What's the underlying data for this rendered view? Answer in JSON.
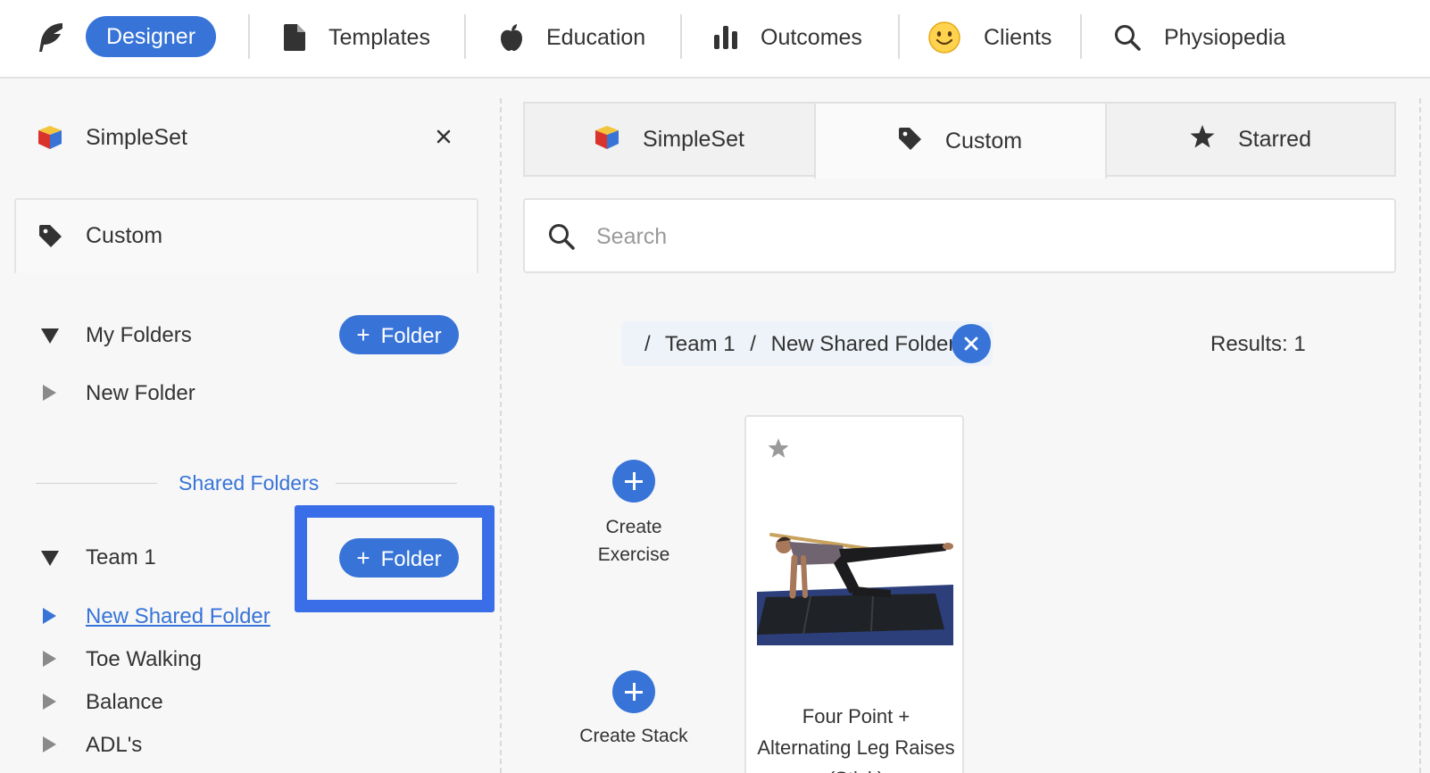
{
  "topnav": {
    "active_label": "Designer",
    "items": [
      {
        "label": "Templates",
        "icon": "file-icon"
      },
      {
        "label": "Education",
        "icon": "apple-icon"
      },
      {
        "label": "Outcomes",
        "icon": "bar-chart-icon"
      },
      {
        "label": "Clients",
        "icon": "smiley-icon"
      },
      {
        "label": "Physiopedia",
        "icon": "search-icon"
      }
    ]
  },
  "sidebar": {
    "title": "SimpleSet",
    "custom_label": "Custom",
    "my_folders": {
      "label": "My Folders",
      "add_button": "Folder",
      "items": [
        "New Folder"
      ]
    },
    "shared_folders_label": "Shared Folders",
    "team": {
      "label": "Team 1",
      "add_button": "Folder",
      "items": [
        "New Shared Folder",
        "Toe Walking",
        "Balance",
        "ADL's"
      ]
    }
  },
  "main": {
    "tabs": [
      {
        "label": "SimpleSet"
      },
      {
        "label": "Custom"
      },
      {
        "label": "Starred"
      }
    ],
    "search_placeholder": "Search",
    "breadcrumb": [
      "/",
      "Team 1",
      "/",
      "New Shared Folder"
    ],
    "results": "Results: 1",
    "create_exercise": "Create Exercise",
    "create_stack": "Create Stack",
    "card_title": "Four Point + Alternating Leg Raises (Stick)"
  },
  "colors": {
    "accent": "#3874d8",
    "highlight": "#3a6ee8"
  }
}
